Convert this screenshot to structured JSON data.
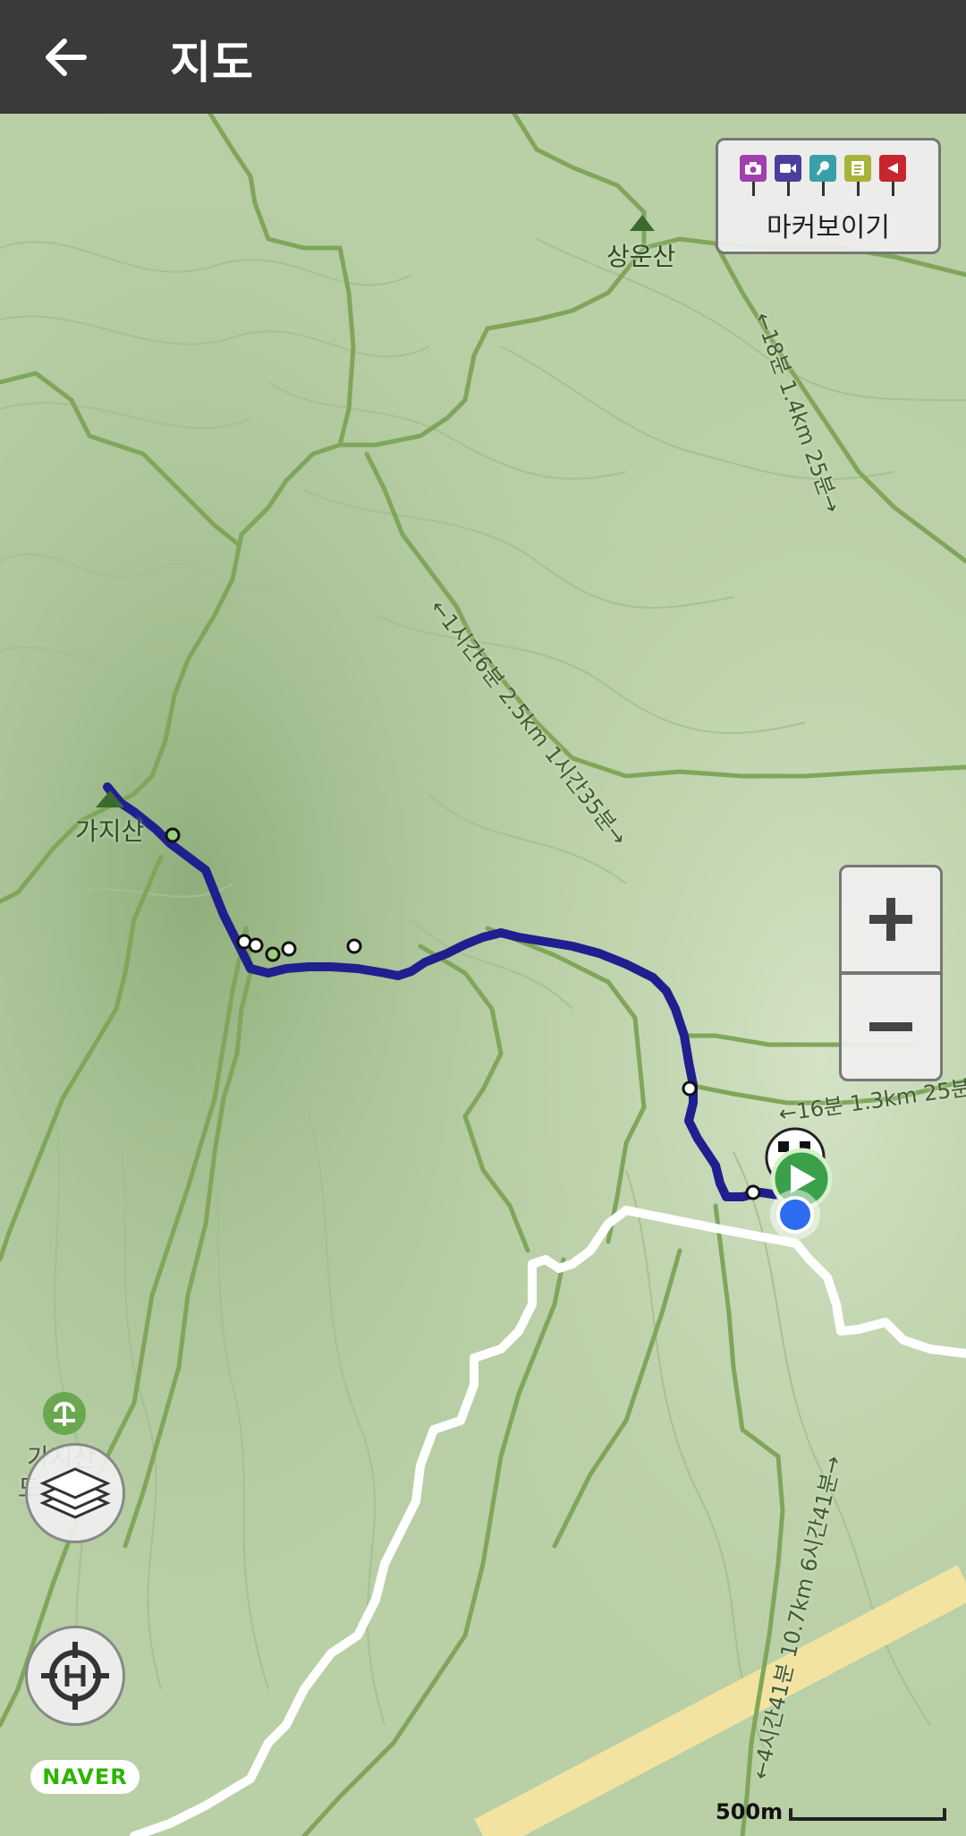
{
  "header": {
    "title": "지도",
    "back_icon": "arrow-back-icon"
  },
  "marker_toggle": {
    "label": "마커보이기",
    "icons": [
      {
        "name": "camera-icon",
        "color": "#a23fb0"
      },
      {
        "name": "video-icon",
        "color": "#4b3f9e"
      },
      {
        "name": "microphone-icon",
        "color": "#3aa0a8"
      },
      {
        "name": "note-icon",
        "color": "#a7b43a"
      },
      {
        "name": "flag-icon",
        "color": "#c6262c"
      }
    ]
  },
  "map": {
    "peaks": [
      {
        "name": "상운산"
      },
      {
        "name": "가지산"
      }
    ],
    "poi": {
      "name_line1": "가지산",
      "name_line2": "도"
    },
    "trail_labels": [
      {
        "text": "←18분 1.4km 25분→"
      },
      {
        "text": "←1시간6분 2.5km 1시간35분→"
      },
      {
        "text": "←16분 1.3km 25분"
      },
      {
        "text": "←4시간41분 10.7km 6시간41분→"
      }
    ],
    "colors": {
      "track": "#1f1f8f",
      "road": "#ffffff",
      "highway": "#f3e3a0",
      "trail": "#7fa65a"
    }
  },
  "zoom": {
    "in_symbol": "+",
    "out_symbol": "−"
  },
  "layers_button": {
    "icon": "layers-icon"
  },
  "locate_button": {
    "icon": "crosshair-icon"
  },
  "attribution": {
    "text": "NAVER"
  },
  "scale": {
    "label": "500m"
  }
}
